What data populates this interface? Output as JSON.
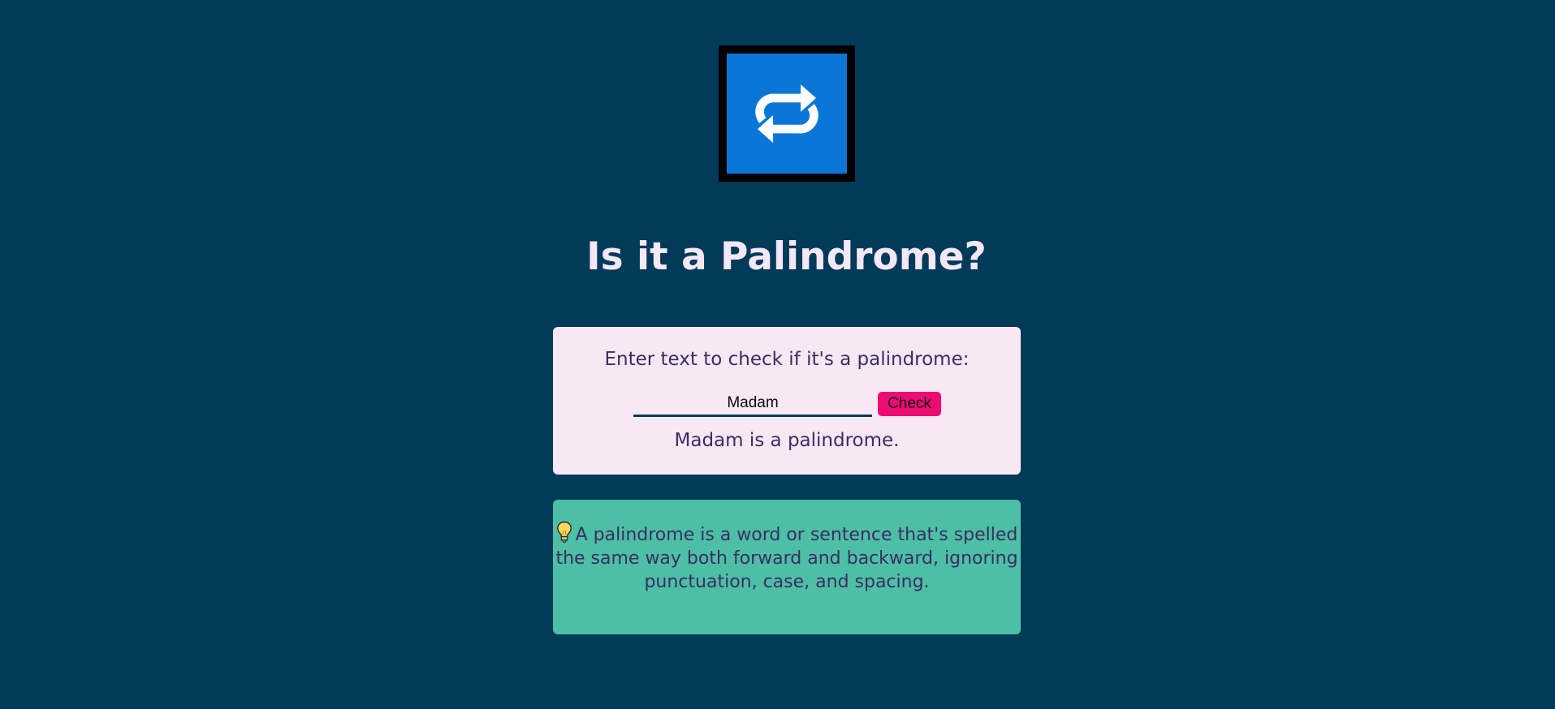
{
  "colors": {
    "background": "#023a5a",
    "logo_blue": "#0a77d6",
    "title": "#f4e8f6",
    "card": "#f7e8f4",
    "accent": "#ec0d73",
    "info_card": "#4cbfa5",
    "text": "#3b2d63"
  },
  "logo": {
    "icon": "repeat-arrows-icon"
  },
  "title": "Is it a Palindrome?",
  "checker": {
    "label": "Enter text to check if it's a palindrome:",
    "input_value": "Madam",
    "button_label": "Check",
    "result": "Madam is a palindrome."
  },
  "info": {
    "icon": "lightbulb-icon",
    "text": "A palindrome is a word or sentence that's spelled the same way both forward and backward, ignoring punctuation, case, and spacing."
  }
}
